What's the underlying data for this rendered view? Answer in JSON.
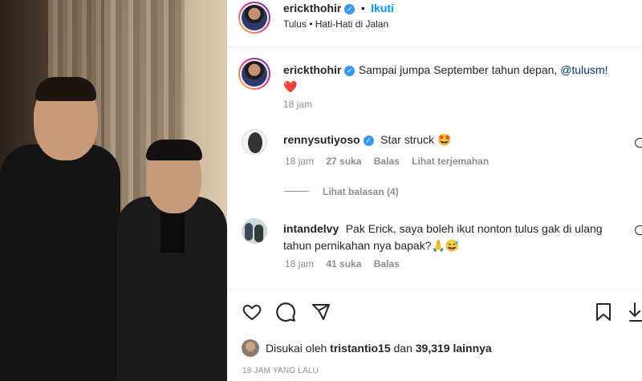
{
  "header": {
    "username": "erickthohir",
    "follow_label": "Ikuti",
    "dot": "•",
    "music": "Tulus • Hati-Hati di Jalan"
  },
  "caption": {
    "username": "erickthohir",
    "text": "Sampai jumpa September tahun depan, ",
    "mention": "@tulusm!",
    "emoji": "❤️",
    "time": "18 jam"
  },
  "comments": [
    {
      "username": "rennysutiyoso",
      "text": "Star struck 🤩",
      "time": "18 jam",
      "likes": "27 suka",
      "reply_label": "Balas",
      "translate_label": "Lihat terjemahan",
      "view_replies": "Lihat balasan (4)"
    },
    {
      "username": "intandelvy",
      "text_line1": "Pak Erick, saya boleh ikut nonton tulus gak di ulang",
      "text_line2": "tahun pernikahan nya bapak?🙏😅",
      "time": "18 jam",
      "likes": "41 suka",
      "reply_label": "Balas"
    }
  ],
  "likes": {
    "prefix": "Disukai oleh ",
    "user": "tristantio15",
    "middle": " dan ",
    "count": "39,319 lainnya"
  },
  "timestamp": "18 JAM YANG LALU",
  "colors": {
    "accent": "#0095f6",
    "verified": "#3897f0",
    "muted": "#8e8e8e"
  },
  "icons": [
    "heart-icon",
    "comment-icon",
    "share-icon",
    "bookmark-icon",
    "verified-icon"
  ]
}
